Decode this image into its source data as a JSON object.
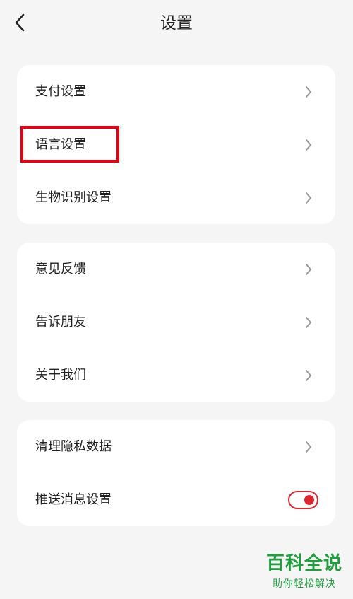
{
  "header": {
    "title": "设置",
    "back_icon": "chevron-left-icon"
  },
  "groups": [
    {
      "items": [
        {
          "label": "支付设置",
          "icon": "chevron-right-icon"
        },
        {
          "label": "语言设置",
          "icon": "chevron-right-icon",
          "highlighted": true
        },
        {
          "label": "生物识别设置",
          "icon": "chevron-right-icon"
        }
      ]
    },
    {
      "items": [
        {
          "label": "意见反馈",
          "icon": "chevron-right-icon"
        },
        {
          "label": "告诉朋友",
          "icon": "chevron-right-icon"
        },
        {
          "label": "关于我们",
          "icon": "chevron-right-icon"
        }
      ]
    },
    {
      "items": [
        {
          "label": "清理隐私数据",
          "icon": "chevron-right-icon"
        },
        {
          "label": "推送消息设置",
          "control": "toggle",
          "enabled": true
        }
      ]
    }
  ],
  "colors": {
    "background": "#f5f5f5",
    "card": "#ffffff",
    "highlight": "#e60012",
    "toggle_accent": "#e0242f",
    "watermark": "#1f9e3c"
  },
  "watermark": {
    "title": "百科全说",
    "subtitle": "助你轻松解决"
  }
}
